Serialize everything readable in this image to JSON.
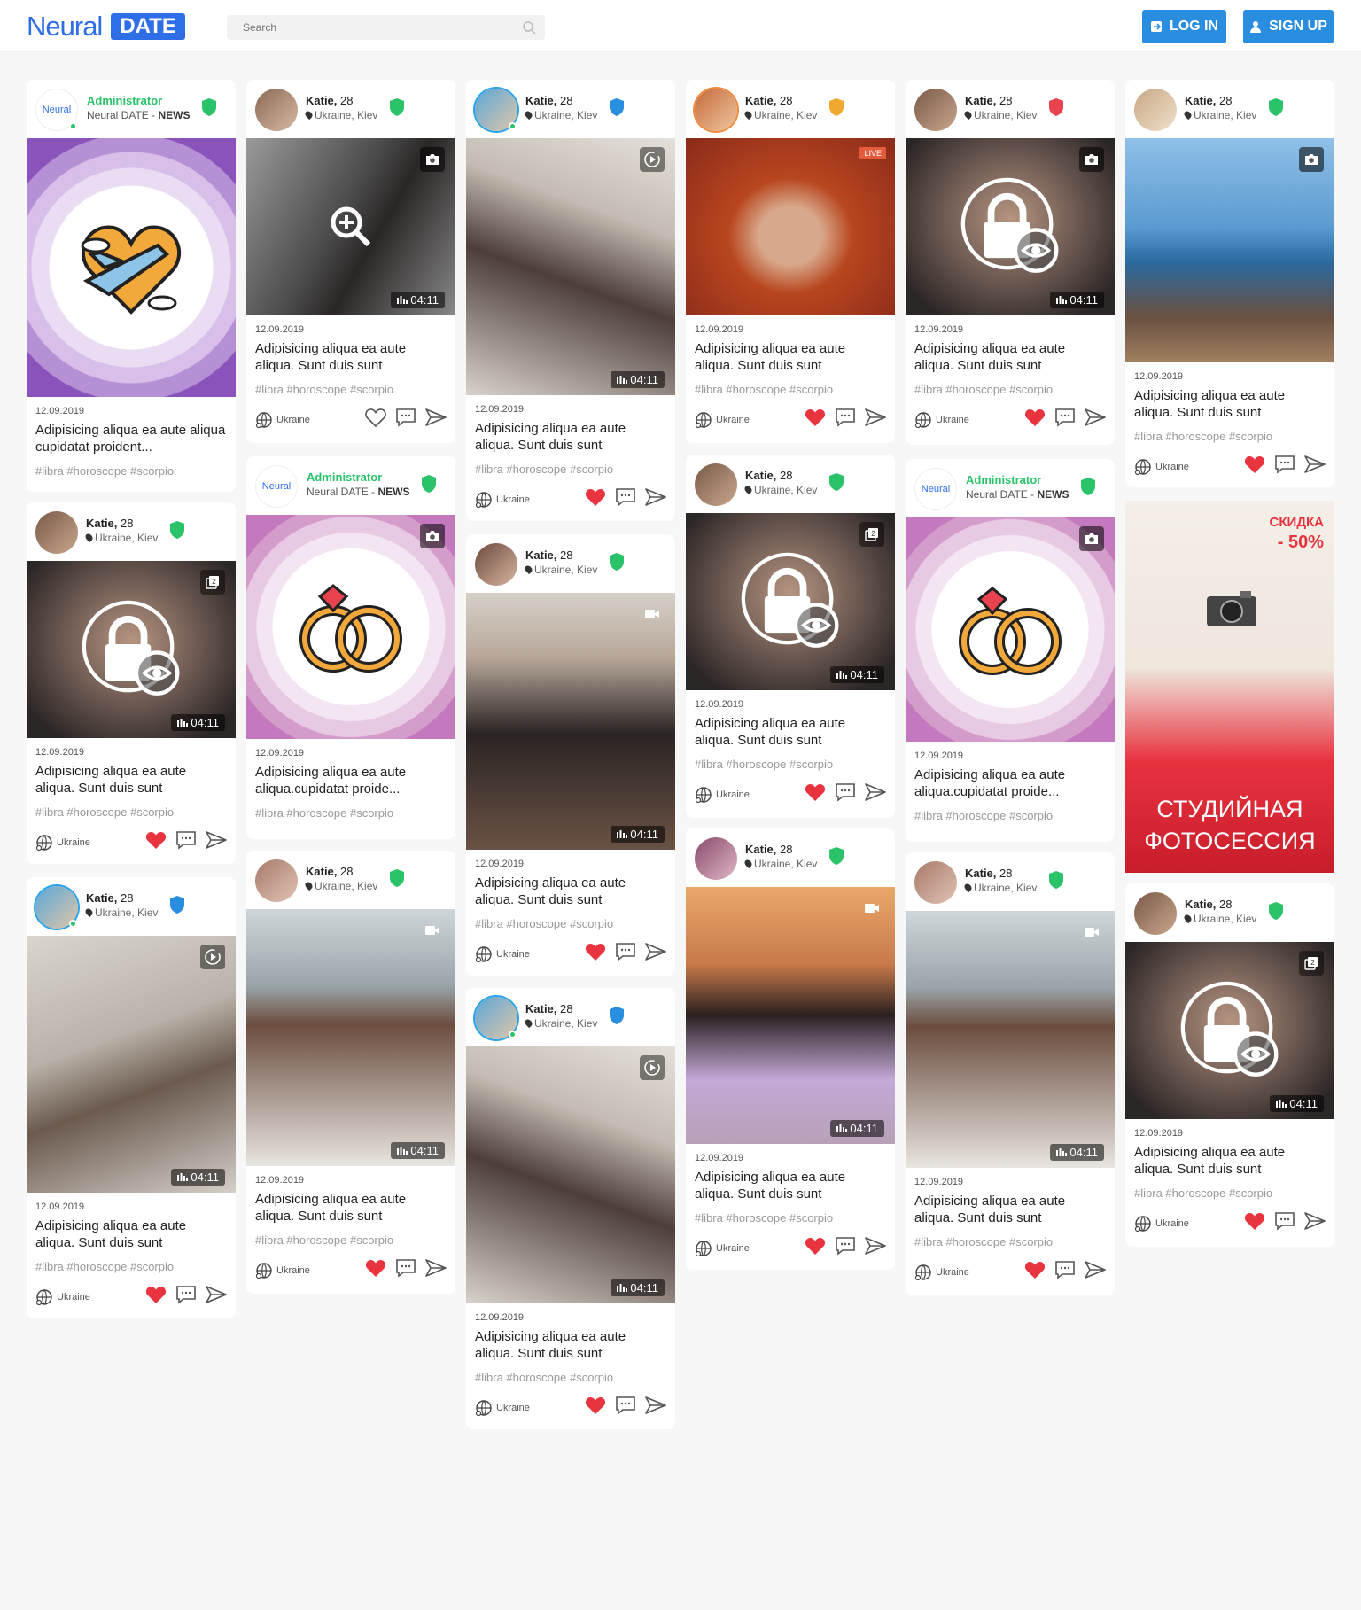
{
  "header": {
    "logo_word": "Neural",
    "logo_badge": "DATE",
    "search_placeholder": "Search",
    "login_label": "LOG IN",
    "signup_label": "SIGN UP"
  },
  "colors": {
    "accent": "#2a8ee0",
    "brand": "#2e6ee6",
    "verified": "#2ac36a",
    "info_shield": "#2a8ee0",
    "warn_shield": "#f0a830",
    "alert_shield": "#e8434f",
    "heart": "#e8343f"
  },
  "common": {
    "user_name": "Katie,",
    "user_age": "28",
    "user_location": "Ukraine, Kiev",
    "admin_name": "Administrator",
    "admin_sub_pre": "Neural DATE - ",
    "admin_sub_bold": "NEWS",
    "date": "12.09.2019",
    "text_short": "Adipisicing aliqua ea aute aliqua. Sunt duis sunt",
    "text_admin_a": "Adipisicing aliqua ea aute aliqua cupidatat proident...",
    "text_admin_b": "Adipisicing aliqua ea aute aliqua.cupidatat proide...",
    "tags": "#libra #horoscope #scorpio",
    "country": "Ukraine",
    "duration": "04:11",
    "live": "LIVE"
  },
  "promo": {
    "discount_line1": "СКИДКА",
    "discount_line2": "- 50%",
    "title_line1": "СТУДИЙНАЯ",
    "title_line2": "ФОТОСЕССИЯ"
  }
}
